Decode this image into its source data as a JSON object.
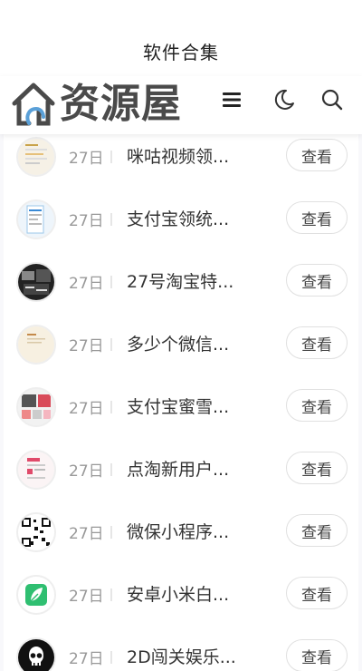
{
  "app": {
    "title": "软件合集"
  },
  "header": {
    "logo_text": "资源屋",
    "icons": [
      "menu-icon",
      "moon-icon",
      "search-icon"
    ],
    "brand_color": "#4a4a4a"
  },
  "list": {
    "items": [
      {
        "date": "27日",
        "name": "咪咕视频领...",
        "action": "查看",
        "thumb": "screenshot-thumb"
      },
      {
        "date": "27日",
        "name": "支付宝领统...",
        "action": "查看",
        "thumb": "screenshot-thumb"
      },
      {
        "date": "27日",
        "name": "27号淘宝特...",
        "action": "查看",
        "thumb": "screenshot-thumb"
      },
      {
        "date": "27日",
        "name": "多少个微信...",
        "action": "查看",
        "thumb": "screenshot-thumb"
      },
      {
        "date": "27日",
        "name": "支付宝蜜雪...",
        "action": "查看",
        "thumb": "screenshot-thumb"
      },
      {
        "date": "27日",
        "name": "点淘新用户...",
        "action": "查看",
        "thumb": "screenshot-thumb"
      },
      {
        "date": "27日",
        "name": "微保小程序...",
        "action": "查看",
        "thumb": "qr-code-thumb"
      },
      {
        "date": "27日",
        "name": "安卓小米白...",
        "action": "查看",
        "thumb": "leaf-app-icon"
      },
      {
        "date": "27日",
        "name": "2D闯关娱乐...",
        "action": "查看",
        "thumb": "skull-app-icon"
      }
    ]
  }
}
